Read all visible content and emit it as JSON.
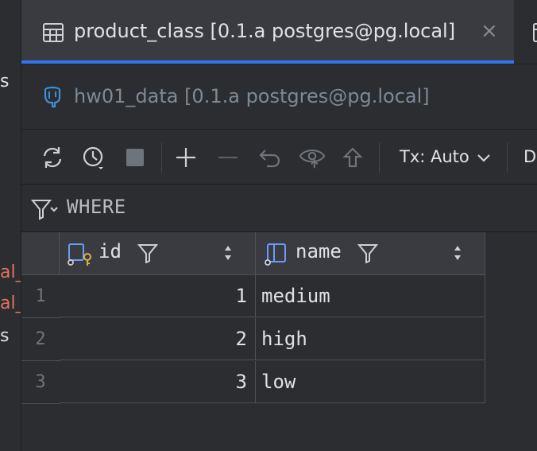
{
  "left_strip": {
    "fragments": [
      {
        "text": "s",
        "color": "#dfe1e5"
      },
      {
        "text": "al_",
        "color": "#e0735f"
      },
      {
        "text": "al_",
        "color": "#e0735f"
      },
      {
        "text": "s",
        "color": "#dfe1e5"
      }
    ]
  },
  "tabs": {
    "active": {
      "label": "product_class [0.1.a postgres@pg.local]",
      "icon": "table-icon",
      "close": "×"
    },
    "next_icon": "table-icon"
  },
  "data_source": {
    "label": "hw01_data [0.1.a postgres@pg.local]",
    "icon": "postgresql-elephant-icon"
  },
  "toolbar": {
    "icons": [
      "refresh-icon",
      "history-clock-icon",
      "stop-icon",
      "add-row-icon",
      "delete-row-icon",
      "revert-icon",
      "preview-changes-icon",
      "submit-icon"
    ],
    "tx_mode": "Tx: Auto",
    "next_label": "D"
  },
  "filter": {
    "label": "WHERE",
    "icon": "filter-icon"
  },
  "grid": {
    "columns": [
      {
        "name": "id",
        "icon": "primary-key-column-icon"
      },
      {
        "name": "name",
        "icon": "column-icon"
      }
    ],
    "rows": [
      {
        "num": "1",
        "id": "1",
        "name": "medium"
      },
      {
        "num": "2",
        "id": "2",
        "name": "high"
      },
      {
        "num": "3",
        "id": "3",
        "name": "low"
      }
    ]
  },
  "colors": {
    "accent": "#3574f0",
    "background": "#2b2d30",
    "panel": "#393b40",
    "key_gold": "#d6b04a",
    "column_blue": "#6b9bfa"
  }
}
